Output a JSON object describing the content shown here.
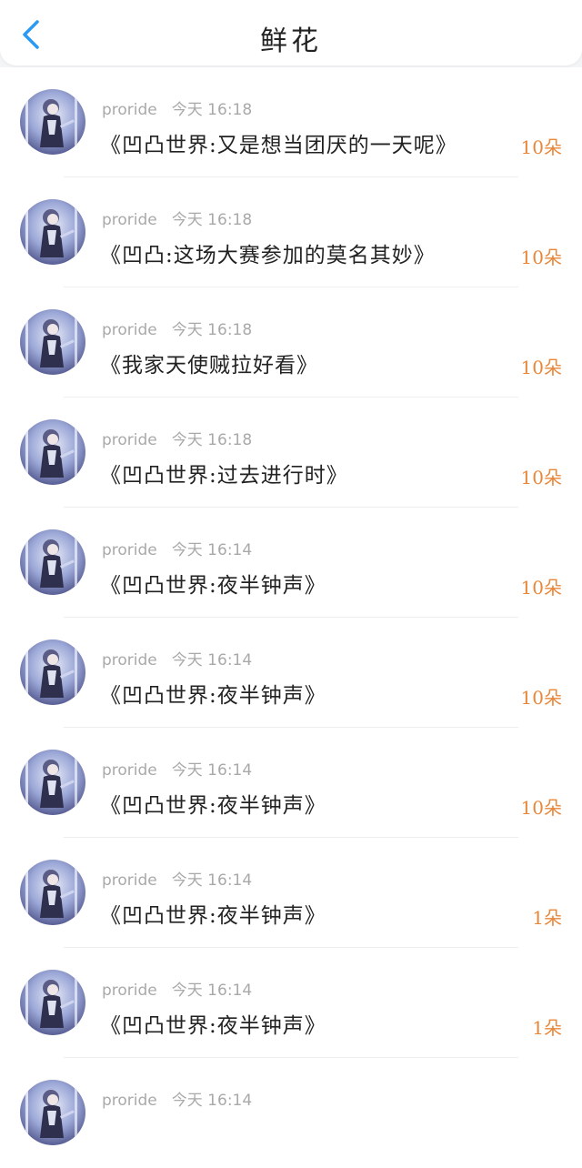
{
  "header": {
    "title": "鲜花",
    "back_icon": "chevron-left-icon",
    "accent": "#2b9af3"
  },
  "items": [
    {
      "name": "proride",
      "time": "今天 16:18",
      "title": "《凹凸世界:又是想当团厌的一天呢》",
      "count": "10朵"
    },
    {
      "name": "proride",
      "time": "今天 16:18",
      "title": "《凹凸:这场大赛参加的莫名其妙》",
      "count": "10朵"
    },
    {
      "name": "proride",
      "time": "今天 16:18",
      "title": "《我家天使贼拉好看》",
      "count": "10朵"
    },
    {
      "name": "proride",
      "time": "今天 16:18",
      "title": "《凹凸世界:过去进行时》",
      "count": "10朵"
    },
    {
      "name": "proride",
      "time": "今天 16:14",
      "title": "《凹凸世界:夜半钟声》",
      "count": "10朵"
    },
    {
      "name": "proride",
      "time": "今天 16:14",
      "title": "《凹凸世界:夜半钟声》",
      "count": "10朵"
    },
    {
      "name": "proride",
      "time": "今天 16:14",
      "title": "《凹凸世界:夜半钟声》",
      "count": "10朵"
    },
    {
      "name": "proride",
      "time": "今天 16:14",
      "title": "《凹凸世界:夜半钟声》",
      "count": "1朵"
    },
    {
      "name": "proride",
      "time": "今天 16:14",
      "title": "《凹凸世界:夜半钟声》",
      "count": "1朵"
    },
    {
      "name": "proride",
      "time": "今天 16:14",
      "title": "",
      "count": ""
    }
  ],
  "colors": {
    "count": "#e8873a",
    "meta": "#a9a9a9",
    "title": "#222222"
  }
}
